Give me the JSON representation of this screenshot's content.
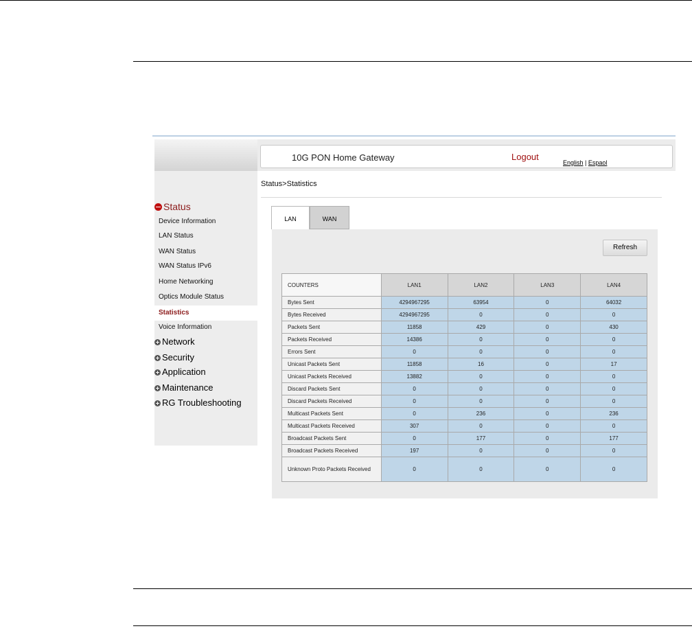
{
  "header": {
    "brand": "10G PON Home Gateway",
    "logout": "Logout",
    "lang_en": "English",
    "lang_sep": " | ",
    "lang_es": "Espaol"
  },
  "breadcrumb": "Status>Statistics",
  "sidebar": {
    "status_label": "Status",
    "items": [
      {
        "label": "Device Information"
      },
      {
        "label": "LAN Status"
      },
      {
        "label": "WAN Status"
      },
      {
        "label": "WAN Status IPv6"
      },
      {
        "label": "Home Networking"
      },
      {
        "label": "Optics Module Status"
      },
      {
        "label": "Statistics",
        "active": true
      },
      {
        "label": "Voice Information"
      }
    ],
    "sections": [
      {
        "label": "Network"
      },
      {
        "label": "Security"
      },
      {
        "label": "Application"
      },
      {
        "label": "Maintenance"
      },
      {
        "label": "RG Troubleshooting"
      }
    ]
  },
  "tabs": [
    {
      "label": "LAN"
    },
    {
      "label": "WAN"
    }
  ],
  "refresh_label": "Refresh",
  "table": {
    "headers": [
      "COUNTERS",
      "LAN1",
      "LAN2",
      "LAN3",
      "LAN4"
    ],
    "rows": [
      [
        "Bytes Sent",
        "4294967295",
        "63954",
        "0",
        "64032"
      ],
      [
        "Bytes Received",
        "4294967295",
        "0",
        "0",
        "0"
      ],
      [
        "Packets Sent",
        "11858",
        "429",
        "0",
        "430"
      ],
      [
        "Packets Received",
        "14386",
        "0",
        "0",
        "0"
      ],
      [
        "Errors Sent",
        "0",
        "0",
        "0",
        "0"
      ],
      [
        "Unicast Packets Sent",
        "11858",
        "16",
        "0",
        "17"
      ],
      [
        "Unicast Packets Received",
        "13882",
        "0",
        "0",
        "0"
      ],
      [
        "Discard Packets Sent",
        "0",
        "0",
        "0",
        "0"
      ],
      [
        "Discard Packets Received",
        "0",
        "0",
        "0",
        "0"
      ],
      [
        "Multicast Packets Sent",
        "0",
        "236",
        "0",
        "236"
      ],
      [
        "Multicast Packets Received",
        "307",
        "0",
        "0",
        "0"
      ],
      [
        "Broadcast Packets Sent",
        "0",
        "177",
        "0",
        "177"
      ],
      [
        "Broadcast Packets Received",
        "197",
        "0",
        "0",
        "0"
      ],
      [
        "Unknown Proto Packets Received",
        "0",
        "0",
        "0",
        "0"
      ]
    ]
  }
}
